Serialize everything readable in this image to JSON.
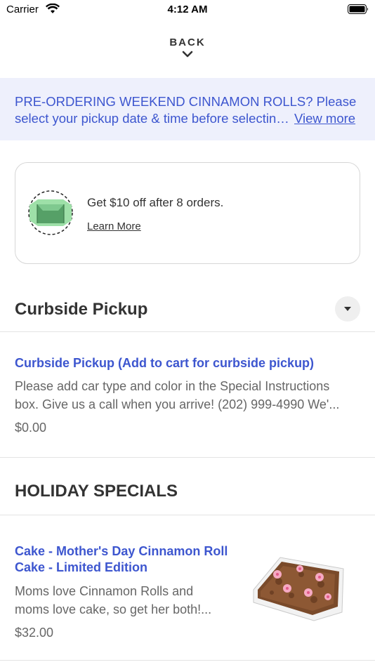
{
  "status_bar": {
    "carrier": "Carrier",
    "time": "4:12 AM",
    "wifi_icon": "wifi-icon",
    "battery_icon": "battery-icon"
  },
  "nav": {
    "back_label": "BACK",
    "back_icon": "chevron-down-icon"
  },
  "banner": {
    "line1": "PRE-ORDERING WEEKEND CINNAMON ROLLS? Please",
    "line2": "select your pickup date & time before selecting items",
    "link": "View more"
  },
  "loyalty": {
    "icon": "box-icon",
    "text": "Get $10 off after 8 orders.",
    "link": "Learn More"
  },
  "sections": {
    "curbside": {
      "title": "Curbside Pickup",
      "toggle_icon": "caret-down-icon",
      "item": {
        "title": "Curbside Pickup (Add to cart for curbside pickup)",
        "desc_line1": "Please add car type and color in the Special Instructions",
        "desc_line2": "box. Give us a call when you arrive! (202) 999-4990 We'...",
        "price": "$0.00"
      }
    },
    "holiday": {
      "title": "HOLIDAY SPECIALS",
      "item": {
        "title_line1": "Cake - Mother's Day Cinnamon Roll",
        "title_line2": "Cake - Limited Edition",
        "desc_line1": "Moms love Cinnamon Rolls and",
        "desc_line2": "moms love cake, so get her both!...",
        "price": "$32.00",
        "image": "cake-photo"
      }
    }
  },
  "colors": {
    "accent": "#3d56cf",
    "banner_bg": "#eef0fc",
    "text": "#333333",
    "muted": "#666666"
  }
}
